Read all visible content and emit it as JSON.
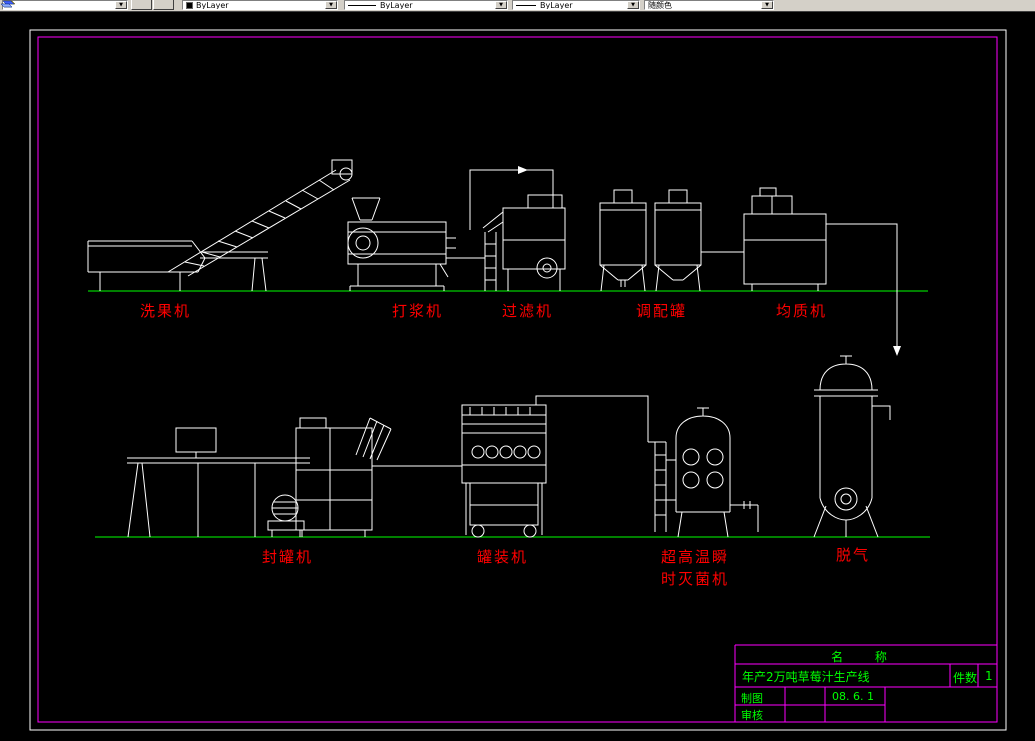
{
  "toolbar": {
    "color_value": "ByLayer",
    "linetype_value": "ByLayer",
    "lineweight_value": "ByLayer",
    "plotstyle_value": "随颜色",
    "dropdown_arrow": "▼"
  },
  "machine_labels": {
    "washer": "洗果机",
    "pulper": "打浆机",
    "filter": "过滤机",
    "blending": "调配罐",
    "homogenizer": "均质机",
    "sealer": "封罐机",
    "filler": "罐装机",
    "sterilizer_line1": "超高温瞬",
    "sterilizer_line2": "时灭菌机",
    "degasser": "脱气"
  },
  "title_block": {
    "name_header": "名 称",
    "product_title": "年产2万吨草莓汁生产线",
    "qty_label": "件数",
    "qty_value": "1",
    "drafted_label": "制图",
    "date": "08. 6. 1",
    "checked_label": "审核"
  },
  "colors": {
    "background": "#000000",
    "drawing_line": "#ffffff",
    "ground_line": "#00ff00",
    "machine_label": "#ff0000",
    "sheet_border": "#ff00ff",
    "titleblock_text": "#00ff00",
    "toolbar_bg": "#d4d0c8"
  }
}
